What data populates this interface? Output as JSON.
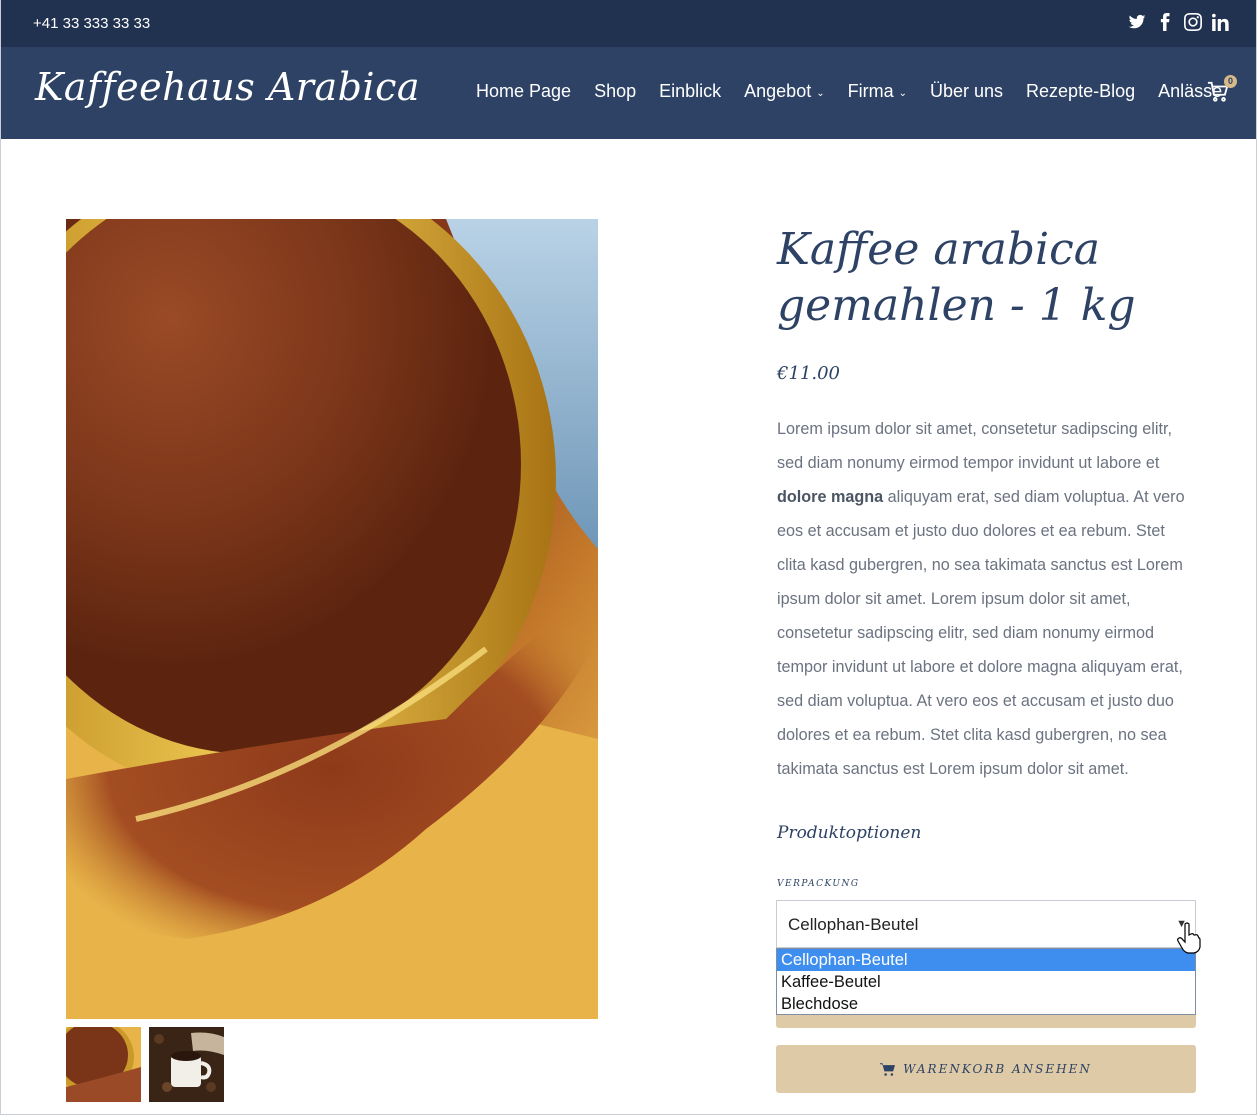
{
  "topbar": {
    "phone": "+41 33 333 33 33",
    "social_icons": [
      "twitter-icon",
      "facebook-icon",
      "instagram-icon",
      "linkedin-icon"
    ]
  },
  "header": {
    "logo": "Kaffeehaus Arabica",
    "nav": [
      {
        "label": "Home Page",
        "has_dropdown": false
      },
      {
        "label": "Shop",
        "has_dropdown": false
      },
      {
        "label": "Einblick",
        "has_dropdown": false
      },
      {
        "label": "Angebot",
        "has_dropdown": true
      },
      {
        "label": "Firma",
        "has_dropdown": true
      },
      {
        "label": "Über uns",
        "has_dropdown": false
      },
      {
        "label": "Rezepte-Blog",
        "has_dropdown": false
      },
      {
        "label": "Anlässe",
        "has_dropdown": false
      }
    ],
    "cart_count": "0"
  },
  "product": {
    "title": "Kaffee arabica gemahlen - 1 kg",
    "price": "€11.00",
    "description_intro": "Lorem ipsum dolor sit amet, consetetur sadipscing elitr, sed diam nonumy eirmod tempor invidunt ut labore et ",
    "description_bold": "dolore magna",
    "description_rest": " aliquyam erat, sed diam voluptua. At vero eos et accusam et justo duo dolores et ea rebum. Stet clita kasd gubergren, no sea takimata sanctus est Lorem ipsum dolor sit amet. Lorem ipsum dolor sit amet, consetetur sadipscing elitr, sed diam nonumy eirmod tempor invidunt ut labore et dolore magna aliquyam erat, sed diam voluptua. At vero eos et accusam et justo duo dolores et ea rebum. Stet clita kasd gubergren, no sea takimata sanctus est Lorem ipsum dolor sit amet.",
    "options_title": "Produktoptionen",
    "option_label": "VERPACKUNG",
    "selected_option": "Cellophan-Beutel",
    "options": [
      "Cellophan-Beutel",
      "Kaffee-Beutel",
      "Blechdose"
    ],
    "cart_button": "WARENKORB ANSEHEN"
  },
  "colors": {
    "topbar": "#213150",
    "header": "#2d4264",
    "accent": "#decaa7",
    "selected": "#3e8ef0"
  }
}
